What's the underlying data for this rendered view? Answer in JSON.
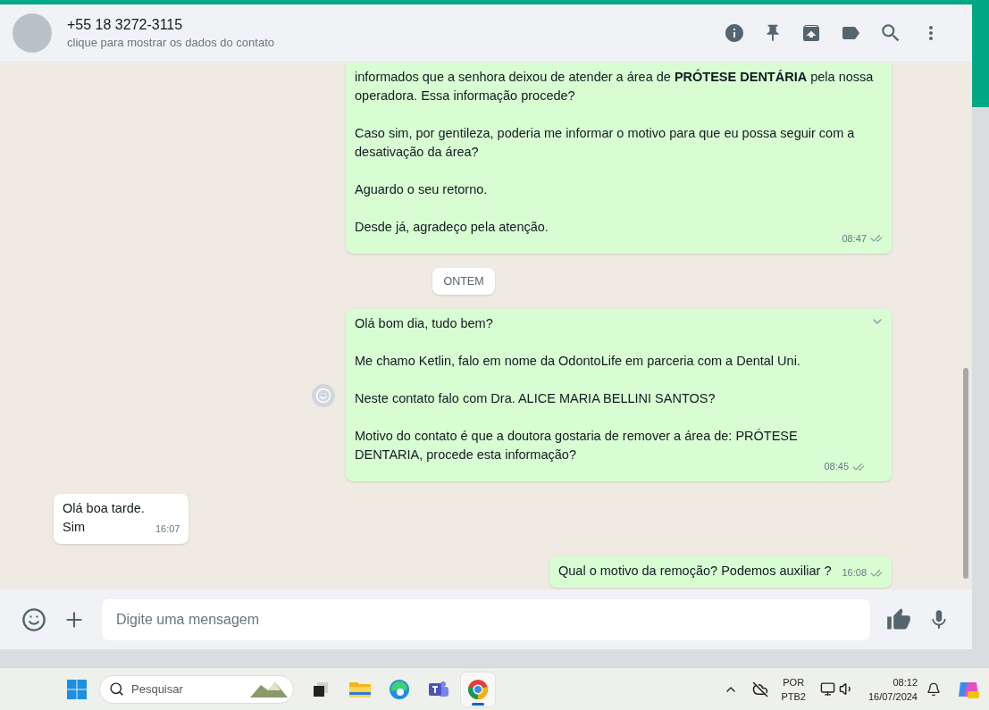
{
  "header": {
    "title": "+55 18 3272-3115",
    "subtitle": "clique para mostrar os dados do contato"
  },
  "messages": [
    {
      "kind": "outgoing",
      "paragraphs": [
        "informados que a senhora deixou de atender a área de **PRÓTESE DENTÁRIA** pela nossa operadora. Essa informação procede?",
        "Caso sim, por gentileza, poderia me informar o motivo para que eu possa seguir com a desativação da área?",
        "Aguardo o seu retorno.",
        "Desde já, agradeço pela atenção."
      ],
      "time": "08:47",
      "read": false,
      "hovered": false,
      "cut_top": true
    },
    {
      "kind": "date",
      "label": "ONTEM"
    },
    {
      "kind": "outgoing",
      "paragraphs": [
        "Olá bom dia, tudo bem?",
        "Me chamo Ketlin, falo em nome da OdontoLife em parceria com a Dental Uni.",
        "Neste contato falo com Dra. ALICE MARIA BELLINI SANTOS?",
        "Motivo do contato é que a doutora gostaria de remover a área de: PRÓTESE DENTARIA, procede esta informação?"
      ],
      "time": "08:45",
      "read": false,
      "hovered": true,
      "cut_top": false
    },
    {
      "kind": "incoming",
      "paragraphs": [
        "Olá boa tarde.\nSim"
      ],
      "time": "16:07",
      "hovered": false,
      "cut_top": false
    },
    {
      "kind": "outgoing",
      "paragraphs": [
        "Qual o motivo da remoção? Podemos auxiliar ?"
      ],
      "time": "16:08",
      "read": false,
      "hovered": false,
      "cut_top": false
    }
  ],
  "composer": {
    "placeholder": "Digite uma mensagem"
  },
  "taskbar": {
    "search_placeholder": "Pesquisar",
    "apps": [
      {
        "kind": "taskview",
        "selected": false
      },
      {
        "kind": "files",
        "selected": false
      },
      {
        "kind": "edge",
        "selected": false
      },
      {
        "kind": "teams",
        "selected": false
      },
      {
        "kind": "chrome",
        "selected": true
      }
    ],
    "language": "POR",
    "layout": "PTB2",
    "time": "08:12",
    "date": "16/07/2024"
  }
}
